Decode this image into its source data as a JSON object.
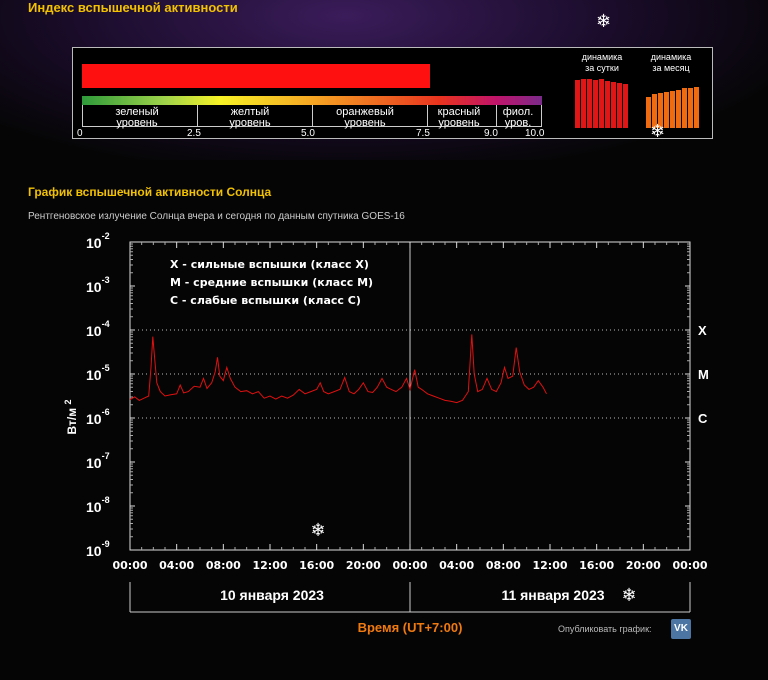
{
  "index": {
    "title": "Индекс вспышечной активности",
    "value": 8.1,
    "scale_ticks": [
      "0",
      "2.5",
      "5.0",
      "7.5",
      "9.0",
      "10.0"
    ],
    "zones": [
      {
        "line1": "зеленый",
        "line2": "уровень",
        "color": "#3fb14a"
      },
      {
        "line1": "желтый",
        "line2": "уровень",
        "color": "#f5e61d"
      },
      {
        "line1": "оранжевый",
        "line2": "уровень",
        "color": "#f0902a"
      },
      {
        "line1": "красный",
        "line2": "уровень",
        "color": "#e8321f"
      },
      {
        "line1": "фиол.",
        "line2": "уров.",
        "color": "#a34bb0"
      }
    ],
    "dyn_day_label_1": "динамика",
    "dyn_day_label_2": "за сутки",
    "dyn_month_label_1": "динамика",
    "dyn_month_label_2": "за месяц",
    "dyn_day_values": [
      8.0,
      8.1,
      8.1,
      8.0,
      8.1,
      7.9,
      7.7,
      7.5,
      7.3
    ],
    "dyn_month_values": [
      5.2,
      5.6,
      5.9,
      6.0,
      6.2,
      6.4,
      6.6,
      6.7,
      6.9
    ],
    "dyn_day_color": "#e01515",
    "dyn_month_color": "#f06a10"
  },
  "chart": {
    "title": "График вспышечной активности Солнца",
    "subtitle": "Рентгеновское излучение Солнца вчера и сегодня по данным спутника GOES-16",
    "legend": [
      "X - сильные вспышки (класс X)",
      "M - средние вспышки (класс M)",
      "C - слабые вспышки (класс C)"
    ],
    "date1": "10 января 2023",
    "date2": "11 января 2023",
    "xlabel": "Время (UT+7:00)",
    "publish_label": "Опубликовать график:",
    "vk_label": "VK"
  },
  "chart_data": {
    "type": "line",
    "ylabel_main": "Вт/м",
    "ylabel_sup": "2",
    "y_scale": "log",
    "ylim_exp": [
      -9,
      -2
    ],
    "y_ticks": [
      {
        "base": "10",
        "exp": "-2"
      },
      {
        "base": "10",
        "exp": "-3"
      },
      {
        "base": "10",
        "exp": "-4"
      },
      {
        "base": "10",
        "exp": "-5"
      },
      {
        "base": "10",
        "exp": "-6"
      },
      {
        "base": "10",
        "exp": "-7"
      },
      {
        "base": "10",
        "exp": "-8"
      },
      {
        "base": "10",
        "exp": "-9"
      }
    ],
    "class_levels": [
      {
        "label": "X",
        "exp": -4
      },
      {
        "label": "M",
        "exp": -5
      },
      {
        "label": "C",
        "exp": -6
      }
    ],
    "x_hours_range": [
      0,
      48
    ],
    "x_tick_labels": [
      "00:00",
      "04:00",
      "08:00",
      "12:00",
      "16:00",
      "20:00",
      "00:00",
      "04:00",
      "08:00",
      "12:00",
      "16:00",
      "20:00",
      "00:00"
    ],
    "day_boundary_hour": 24,
    "line_color": "#e01010",
    "series_log10": [
      [
        0.0,
        -5.58
      ],
      [
        0.4,
        -5.52
      ],
      [
        0.8,
        -5.6
      ],
      [
        1.2,
        -5.55
      ],
      [
        1.6,
        -5.5
      ],
      [
        1.8,
        -4.85
      ],
      [
        1.95,
        -4.15
      ],
      [
        2.1,
        -4.6
      ],
      [
        2.3,
        -5.2
      ],
      [
        2.6,
        -5.4
      ],
      [
        3.0,
        -5.5
      ],
      [
        3.5,
        -5.47
      ],
      [
        4.0,
        -5.45
      ],
      [
        4.3,
        -5.25
      ],
      [
        4.6,
        -5.43
      ],
      [
        5.0,
        -5.4
      ],
      [
        5.5,
        -5.28
      ],
      [
        6.0,
        -5.3
      ],
      [
        6.3,
        -5.1
      ],
      [
        6.6,
        -5.33
      ],
      [
        7.0,
        -5.2
      ],
      [
        7.3,
        -4.95
      ],
      [
        7.5,
        -4.62
      ],
      [
        7.7,
        -5.05
      ],
      [
        8.0,
        -5.15
      ],
      [
        8.3,
        -4.85
      ],
      [
        8.6,
        -5.1
      ],
      [
        9.0,
        -5.3
      ],
      [
        9.5,
        -5.4
      ],
      [
        10.0,
        -5.38
      ],
      [
        10.5,
        -5.45
      ],
      [
        11.0,
        -5.4
      ],
      [
        11.5,
        -5.55
      ],
      [
        12.0,
        -5.5
      ],
      [
        12.5,
        -5.57
      ],
      [
        13.0,
        -5.5
      ],
      [
        13.5,
        -5.55
      ],
      [
        14.0,
        -5.48
      ],
      [
        14.5,
        -5.35
      ],
      [
        15.0,
        -5.45
      ],
      [
        15.5,
        -5.4
      ],
      [
        16.0,
        -5.35
      ],
      [
        16.3,
        -5.2
      ],
      [
        16.6,
        -5.4
      ],
      [
        17.0,
        -5.45
      ],
      [
        17.5,
        -5.4
      ],
      [
        18.0,
        -5.35
      ],
      [
        18.4,
        -5.08
      ],
      [
        18.8,
        -5.4
      ],
      [
        19.2,
        -5.45
      ],
      [
        19.6,
        -5.35
      ],
      [
        20.0,
        -5.2
      ],
      [
        20.4,
        -5.4
      ],
      [
        20.8,
        -5.42
      ],
      [
        21.2,
        -5.3
      ],
      [
        21.6,
        -5.1
      ],
      [
        22.0,
        -5.3
      ],
      [
        22.4,
        -5.35
      ],
      [
        22.8,
        -5.4
      ],
      [
        23.3,
        -5.3
      ],
      [
        23.7,
        -5.1
      ],
      [
        24.0,
        -5.35
      ],
      [
        24.4,
        -4.9
      ],
      [
        24.7,
        -5.3
      ],
      [
        25.0,
        -5.35
      ],
      [
        25.5,
        -5.45
      ],
      [
        26.0,
        -5.5
      ],
      [
        26.5,
        -5.55
      ],
      [
        27.0,
        -5.6
      ],
      [
        27.5,
        -5.62
      ],
      [
        28.0,
        -5.65
      ],
      [
        28.5,
        -5.6
      ],
      [
        29.0,
        -5.4
      ],
      [
        29.3,
        -4.1
      ],
      [
        29.5,
        -5.0
      ],
      [
        29.8,
        -5.4
      ],
      [
        30.2,
        -5.35
      ],
      [
        30.6,
        -5.1
      ],
      [
        31.0,
        -5.35
      ],
      [
        31.4,
        -5.4
      ],
      [
        31.8,
        -5.2
      ],
      [
        32.1,
        -4.85
      ],
      [
        32.4,
        -5.1
      ],
      [
        32.8,
        -5.05
      ],
      [
        33.1,
        -4.4
      ],
      [
        33.4,
        -4.95
      ],
      [
        33.8,
        -5.25
      ],
      [
        34.2,
        -5.35
      ],
      [
        34.6,
        -5.3
      ],
      [
        35.0,
        -5.15
      ],
      [
        35.4,
        -5.3
      ],
      [
        35.7,
        -5.45
      ]
    ]
  }
}
